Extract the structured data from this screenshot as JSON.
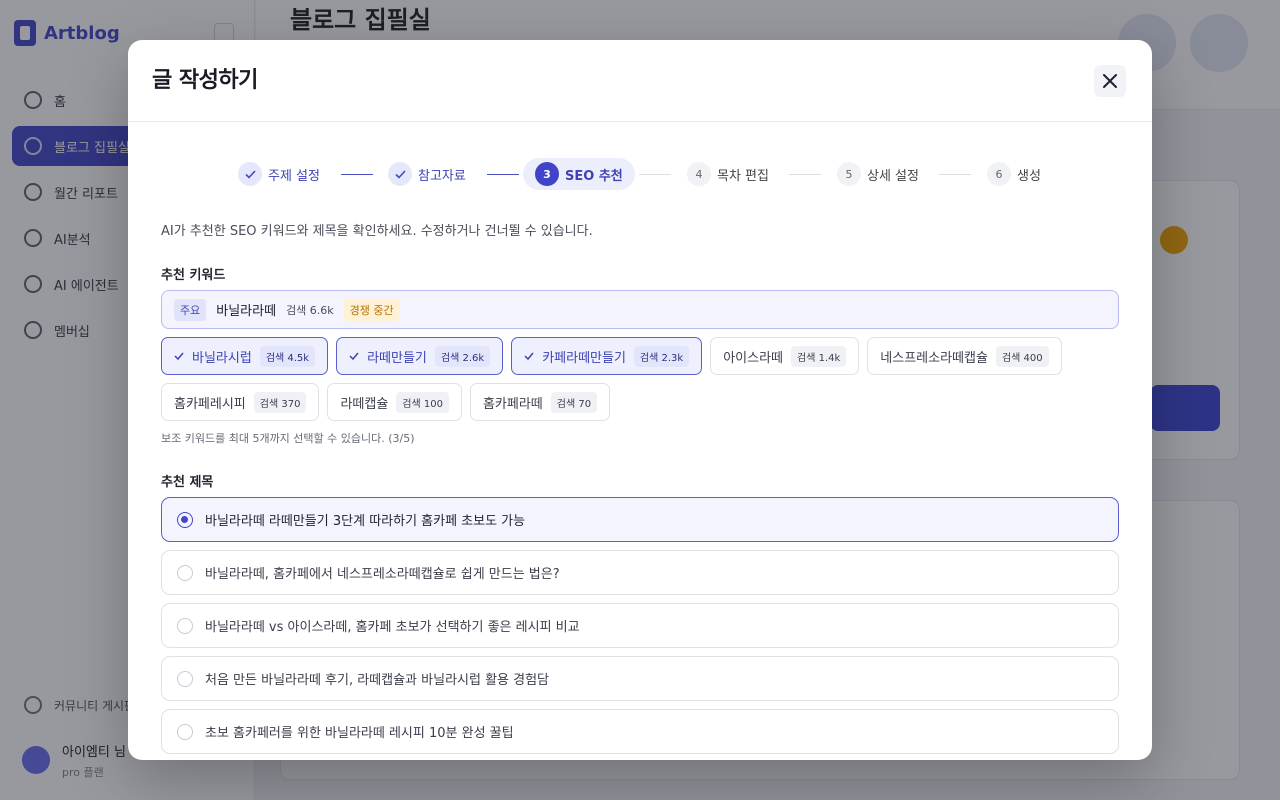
{
  "background": {
    "logo_text": "Artblog",
    "page_title": "블로그 집필실",
    "nav": [
      "홈",
      "블로그 집필실",
      "월간 리포트",
      "AI분석",
      "AI 에이전트",
      "멤버십"
    ],
    "footer_item": "커뮤니티 게시판",
    "user_name": "아이엠티 님",
    "user_sub": "pro 플랜"
  },
  "modal": {
    "title": "글 작성하기",
    "steps": [
      {
        "num": "1",
        "label": "주제 설정",
        "state": "done"
      },
      {
        "num": "2",
        "label": "참고자료",
        "state": "done"
      },
      {
        "num": "3",
        "label": "SEO 추천",
        "state": "current"
      },
      {
        "num": "4",
        "label": "목차 편집",
        "state": "pending"
      },
      {
        "num": "5",
        "label": "상세 설정",
        "state": "pending"
      },
      {
        "num": "6",
        "label": "생성",
        "state": "pending"
      }
    ],
    "description": "AI가 추천한 SEO 키워드와 제목을 확인하세요. 수정하거나 건너뛸 수 있습니다.",
    "keywords_label": "추천 키워드",
    "main_keyword": {
      "tag": "주요",
      "text": "바닐라라떼",
      "count": "검색 6.6k",
      "competition": "경쟁 중간"
    },
    "keywords_row1": [
      {
        "text": "바닐라시럽",
        "count": "검색 4.5k",
        "selected": true
      },
      {
        "text": "라떼만들기",
        "count": "검색 2.6k",
        "selected": true
      },
      {
        "text": "카페라떼만들기",
        "count": "검색 2.3k",
        "selected": true
      },
      {
        "text": "아이스라떼",
        "count": "검색 1.4k",
        "selected": false
      },
      {
        "text": "네스프레소라떼캡슐",
        "count": "검색 400",
        "selected": false
      }
    ],
    "keywords_row2": [
      {
        "text": "홈카페레시피",
        "count": "검색 370",
        "selected": false
      },
      {
        "text": "라떼캡슐",
        "count": "검색 100",
        "selected": false
      },
      {
        "text": "홈카페라떼",
        "count": "검색 70",
        "selected": false
      }
    ],
    "keyword_hint": "보조 키워드를 최대 5개까지 선택할 수 있습니다. (3/5)",
    "titles_label": "추천 제목",
    "titles": [
      {
        "text": "바닐라라떼 라떼만들기 3단계 따라하기 홈카페 초보도 가능",
        "selected": true
      },
      {
        "text": "바닐라라떼, 홈카페에서 네스프레소라떼캡슐로 쉽게 만드는 법은?",
        "selected": false
      },
      {
        "text": "바닐라라떼 vs 아이스라떼, 홈카페 초보가 선택하기 좋은 레시피 비교",
        "selected": false
      },
      {
        "text": "처음 만든 바닐라라떼 후기, 라떼캡슐과 바닐라시럽 활용 경험담",
        "selected": false
      },
      {
        "text": "초보 홈카페러를 위한 바닐라라떼 레시피 10분 완성 꿀팁",
        "selected": false
      }
    ]
  },
  "colors": {
    "accent": "#3f44c8",
    "selected_border": "#5a5fd0",
    "selected_bg": "#eef0fd",
    "competition_bg": "#fff1d6",
    "competition_text": "#b77207"
  }
}
